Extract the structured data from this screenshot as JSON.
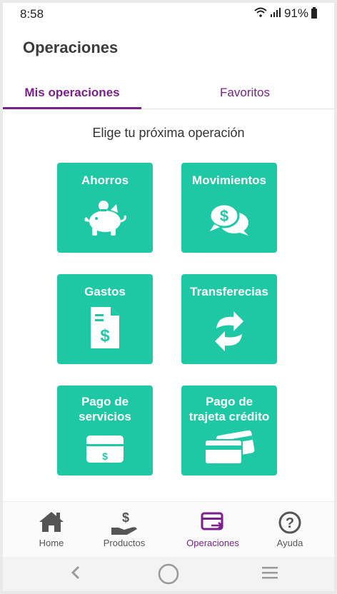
{
  "status": {
    "time": "8:58",
    "battery": "91%"
  },
  "header": {
    "title": "Operaciones"
  },
  "tabs": [
    {
      "label": "Mis operaciones",
      "active": true
    },
    {
      "label": "Favoritos",
      "active": false
    }
  ],
  "subtitle": "Elige tu próxima operación",
  "operations": [
    {
      "label": "Ahorros",
      "icon": "piggy-bank-icon"
    },
    {
      "label": "Movimientos",
      "icon": "money-chat-icon"
    },
    {
      "label": "Gastos",
      "icon": "document-dollar-icon"
    },
    {
      "label": "Transferecias",
      "icon": "transfer-arrows-icon"
    },
    {
      "label_line1": "Pago de",
      "label_line2": "servicios",
      "icon": "bill-dollar-icon"
    },
    {
      "label_line1": "Pago de",
      "label_line2": "trajeta crédito",
      "icon": "credit-cards-icon"
    }
  ],
  "bottom_nav": [
    {
      "label": "Home",
      "icon": "home-icon",
      "active": false
    },
    {
      "label": "Productos",
      "icon": "hand-dollar-icon",
      "active": false
    },
    {
      "label": "Operaciones",
      "icon": "card-transfer-icon",
      "active": true
    },
    {
      "label": "Ayuda",
      "icon": "help-circle-icon",
      "active": false
    }
  ],
  "colors": {
    "accent": "#7b1f8c",
    "tile": "#1fc8a5"
  }
}
